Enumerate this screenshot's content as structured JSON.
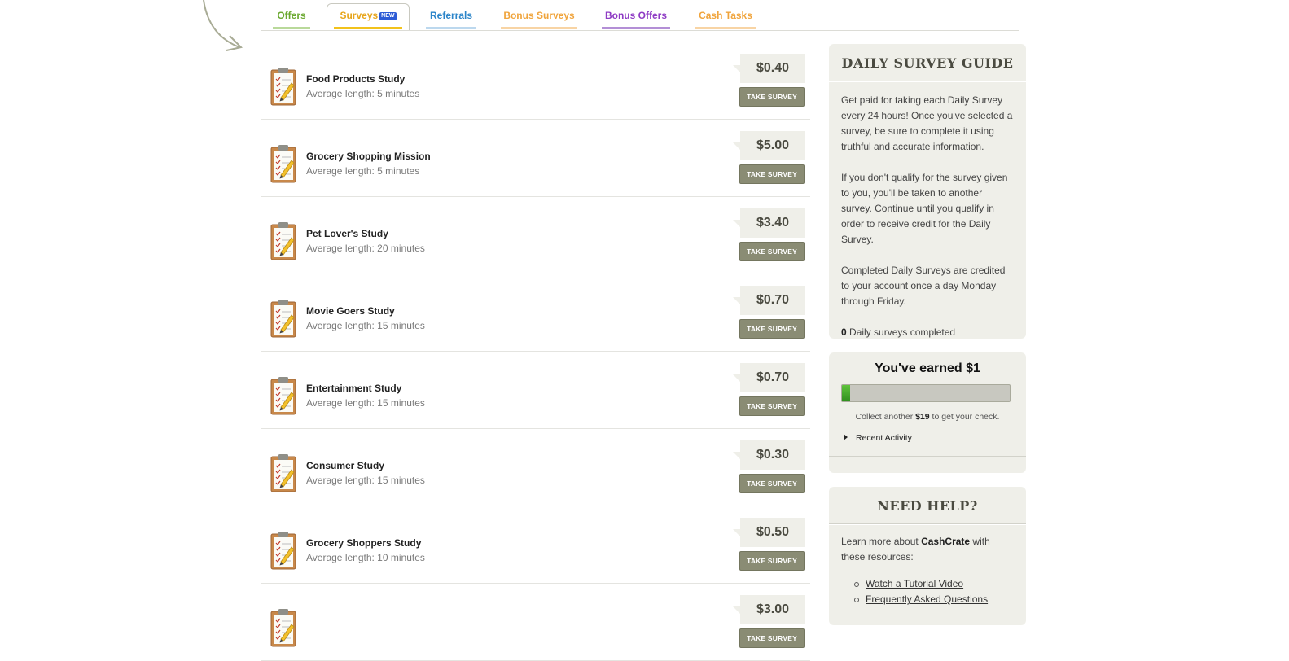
{
  "tabs": [
    {
      "label": "Offers",
      "color": "#6aa82f",
      "bar": "#b9d99a"
    },
    {
      "label": "Surveys",
      "color": "#e7a51b",
      "bar": "#f2c21b",
      "badge": "NEW"
    },
    {
      "label": "Referrals",
      "color": "#2a84c9",
      "bar": "#bcd8ee"
    },
    {
      "label": "Bonus Surveys",
      "color": "#f0a43c",
      "bar": "#f8d4a4"
    },
    {
      "label": "Bonus Offers",
      "color": "#8e3bc4",
      "bar": "#b38fd6"
    },
    {
      "label": "Cash Tasks",
      "color": "#f0a43c",
      "bar": "#f8d4a4"
    }
  ],
  "surveys": [
    {
      "title": "Food Products Study",
      "length": "Average length: 5 minutes",
      "price": "$0.40",
      "button": "TAKE SURVEY"
    },
    {
      "title": "Grocery Shopping Mission",
      "length": "Average length: 5 minutes",
      "price": "$5.00",
      "button": "TAKE SURVEY"
    },
    {
      "title": "Pet Lover's Study",
      "length": "Average length: 20 minutes",
      "price": "$3.40",
      "button": "TAKE SURVEY"
    },
    {
      "title": "Movie Goers Study",
      "length": "Average length: 15 minutes",
      "price": "$0.70",
      "button": "TAKE SURVEY"
    },
    {
      "title": "Entertainment Study",
      "length": "Average length: 15 minutes",
      "price": "$0.70",
      "button": "TAKE SURVEY"
    },
    {
      "title": "Consumer Study",
      "length": "Average length: 15 minutes",
      "price": "$0.30",
      "button": "TAKE SURVEY"
    },
    {
      "title": "Grocery Shoppers Study",
      "length": "Average length: 10 minutes",
      "price": "$0.50",
      "button": "TAKE SURVEY"
    },
    {
      "title": "",
      "length": "",
      "price": "$3.00",
      "button": "TAKE SURVEY"
    }
  ],
  "guide": {
    "title": "DAILY SURVEY GUIDE",
    "p1": "Get paid for taking each Daily Survey every 24 hours! Once you've selected a survey, be sure to complete it using truthful and accurate information.",
    "p2": "If you don't qualify for the survey given to you, you'll be taken to another survey. Continue until you qualify in order to receive credit for the Daily Survey.",
    "p3": "Completed Daily Surveys are credited to your account once a day Monday through Friday.",
    "completed_count": "0",
    "completed_label": " Daily surveys completed"
  },
  "earnings": {
    "title": "You've earned $1",
    "progress_fraction": 0.05,
    "collect_pre": "Collect another ",
    "collect_amount": "$19",
    "collect_post": " to get your check.",
    "recent_activity": "Recent Activity"
  },
  "help": {
    "title": "NEED HELP?",
    "intro_pre": "Learn more about ",
    "brand": "CashCrate",
    "intro_post": " with these resources:",
    "links": [
      "Watch a Tutorial Video",
      "Frequently Asked Questions"
    ]
  }
}
